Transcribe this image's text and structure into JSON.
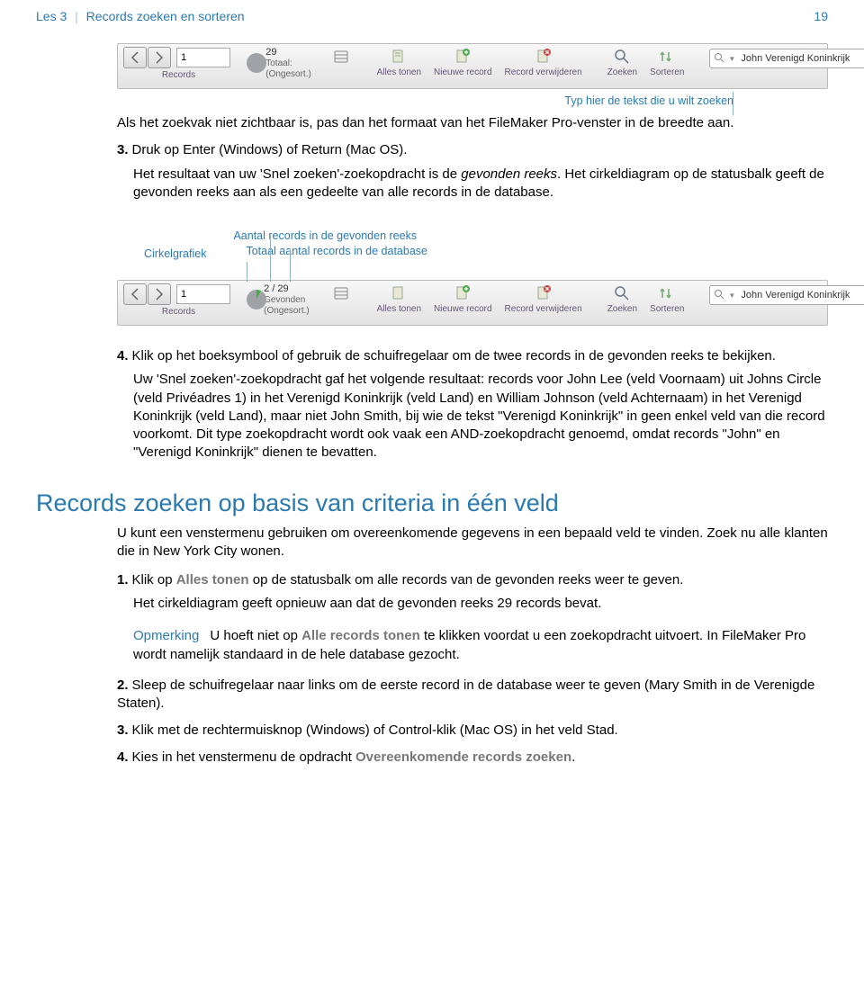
{
  "header": {
    "lesson": "Les 3",
    "title": "Records zoeken en sorteren",
    "page": "19"
  },
  "callout_search": "Typ hier de tekst die u wilt zoeken",
  "toolbar1": {
    "record_value": "1",
    "total": "29",
    "status": "Totaal: (Ongesort.)",
    "records_label": "Records",
    "alles_tonen": "Alles tonen",
    "nieuwe_record": "Nieuwe record",
    "record_verwijderen": "Record verwijderen",
    "zoeken": "Zoeken",
    "sorteren": "Sorteren",
    "search_value": "John Verenigd Koninkrijk"
  },
  "para1": "Als het zoekvak niet zichtbaar is, pas dan het formaat van het FileMaker Pro-venster in de breedte aan.",
  "step3_num": "3.",
  "step3": "Druk op Enter (Windows) of Return (Mac OS).",
  "step3_sub_a": "Het resultaat van uw 'Snel zoeken'-zoekopdracht is de ",
  "step3_sub_b": "gevonden reeks",
  "step3_sub_c": ". Het cirkeldiagram op de statusbalk geeft de gevonden reeks aan als een gedeelte van alle records in de database.",
  "callouts2": {
    "cirkel": "Cirkelgrafiek",
    "aantal": "Aantal records in de gevonden reeks",
    "totaal": "Totaal aantal records in de database"
  },
  "toolbar2": {
    "record_value": "1",
    "found_total": "2 / 29",
    "status": "Gevonden (Ongesort.)",
    "records_label": "Records",
    "alles_tonen": "Alles tonen",
    "nieuwe_record": "Nieuwe record",
    "record_verwijderen": "Record verwijderen",
    "zoeken": "Zoeken",
    "sorteren": "Sorteren",
    "search_value": "John Verenigd Koninkrijk"
  },
  "step4_num": "4.",
  "step4": "Klik op het boeksymbool of gebruik de schuifregelaar om de twee records in de gevonden reeks te bekijken.",
  "step4_sub": "Uw 'Snel zoeken'-zoekopdracht gaf het volgende resultaat: records voor John Lee (veld Voornaam) uit Johns Circle (veld Privéadres 1) in het Verenigd Koninkrijk (veld Land) en William Johnson (veld Achternaam) in het Verenigd Koninkrijk (veld Land), maar niet John Smith, bij wie de tekst \"Verenigd Koninkrijk\" in geen enkel veld van die record voorkomt. Dit type zoekopdracht wordt ook vaak een AND-zoekopdracht genoemd, omdat records \"John\" en \"Verenigd Koninkrijk\" dienen te bevatten.",
  "section2_title": "Records zoeken op basis van criteria in één veld",
  "section2_intro": "U kunt een venstermenu gebruiken om overeenkomende gegevens in een bepaald veld te vinden. Zoek nu alle klanten die in New York City wonen.",
  "s2_step1_num": "1.",
  "s2_step1_a": "Klik op ",
  "s2_step1_b": "Alles tonen",
  "s2_step1_c": " op de statusbalk om alle records van de gevonden reeks weer te geven.",
  "s2_step1_sub": "Het cirkeldiagram geeft opnieuw aan dat de gevonden reeks 29 records bevat.",
  "note_label": "Opmerking",
  "note_a": "U hoeft niet op ",
  "note_b": "Alle records tonen",
  "note_c": " te klikken voordat u een zoekopdracht uitvoert. In FileMaker Pro wordt namelijk standaard in de hele database gezocht.",
  "s2_step2_num": "2.",
  "s2_step2": "Sleep de schuifregelaar naar links om de eerste record in de database weer te geven (Mary Smith in de Verenigde Staten).",
  "s2_step3_num": "3.",
  "s2_step3": "Klik met de rechtermuisknop (Windows) of Control-klik (Mac OS) in het veld Stad.",
  "s2_step4_num": "4.",
  "s2_step4_a": "Kies in het venstermenu de opdracht ",
  "s2_step4_b": "Overeenkomende records zoeken",
  "s2_step4_c": "."
}
